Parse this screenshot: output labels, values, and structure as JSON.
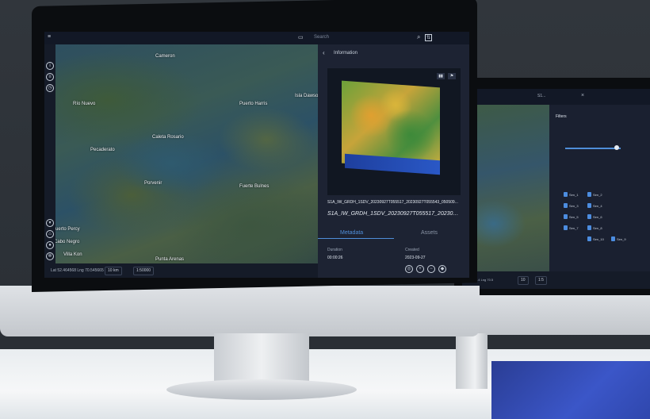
{
  "main_screen": {
    "search": {
      "placeholder": "Search"
    },
    "map_labels": [
      "Cameron",
      "Río Nuevo",
      "Caleta Rosario",
      "Puerto Harris",
      "Isla Dawson",
      "Pecaderato",
      "Porvenir",
      "Fuerte Bulnes",
      "Puerto Percy",
      "Cabo Negro",
      "Villa Kon",
      "Punta Arenas"
    ],
    "coordinates_text": "Lat 52.464568 Lng 70.545665",
    "bottom_selects": [
      "10 km",
      "1:50000"
    ],
    "panel": {
      "back_label": "Information",
      "file_name_small": "S1A_IW_GRDH_1SDV_20230927T055517_20230927T055543_050509...",
      "file_name_large": "S1A_IW_GRDH_1SDV_20230927T055517_20230927T055543_050509...",
      "tabs": [
        "Metadata",
        "Assets"
      ],
      "meta_fields": [
        {
          "label": "Duration",
          "value": "00:00:26"
        },
        {
          "label": "Created",
          "value": "2023-09-27"
        }
      ]
    }
  },
  "second_screen": {
    "title": "Filters",
    "search_value": "S1...",
    "coordinates_text": "Lat 52.4 Lng 70.5",
    "bottom_selects": [
      "10",
      "1:5"
    ],
    "folders": [
      "Sen_1",
      "Sen_2",
      "Sen_3",
      "Sen_4",
      "Sen_5",
      "Sen_6",
      "Sen_7",
      "Sen_8",
      "Sen_9",
      "Sen_10"
    ]
  },
  "colors": {
    "accent": "#4f8ed9",
    "panel_bg": "#1d2333",
    "folder": "#4c8de0"
  }
}
